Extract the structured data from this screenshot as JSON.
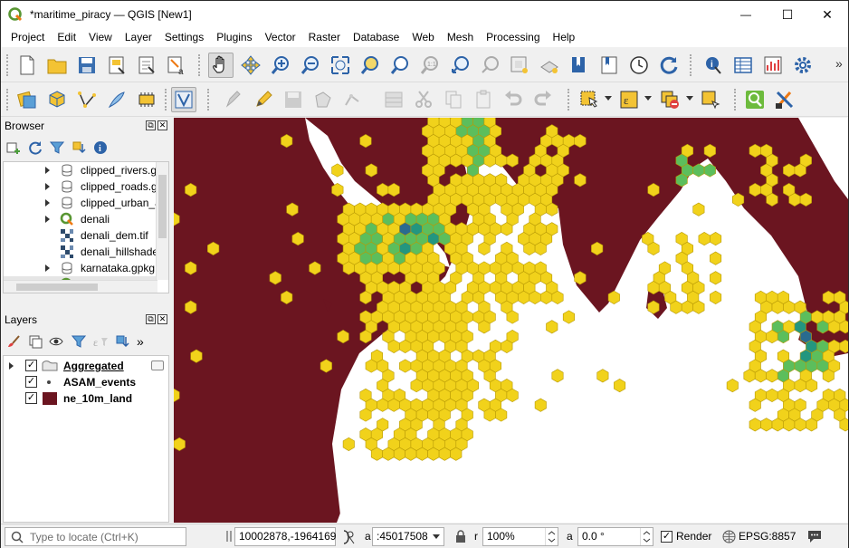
{
  "window": {
    "title": "*maritime_piracy — QGIS [New1]",
    "minimize_glyph": "—",
    "maximize_glyph": "☐",
    "close_glyph": "✕"
  },
  "menu": [
    "Project",
    "Edit",
    "View",
    "Layer",
    "Settings",
    "Plugins",
    "Vector",
    "Raster",
    "Database",
    "Web",
    "Mesh",
    "Processing",
    "Help"
  ],
  "toolbar_overflow": "»",
  "browser": {
    "title": "Browser",
    "items": [
      {
        "label": "clipped_rivers.g",
        "icon": "geopackage-icon",
        "expandable": true
      },
      {
        "label": "clipped_roads.g",
        "icon": "geopackage-icon",
        "expandable": true
      },
      {
        "label": "clipped_urban_a",
        "icon": "geopackage-icon",
        "expandable": true
      },
      {
        "label": "denali",
        "icon": "qgis-project-icon",
        "expandable": true
      },
      {
        "label": "denali_dem.tif",
        "icon": "raster-icon",
        "expandable": false
      },
      {
        "label": "denali_hillshade",
        "icon": "raster-icon",
        "expandable": false
      },
      {
        "label": "karnataka.gpkg",
        "icon": "geopackage-icon",
        "expandable": true
      },
      {
        "label": "maritime_piracy",
        "icon": "qgis-project-icon",
        "expandable": true,
        "selected": true
      }
    ]
  },
  "layers": {
    "title": "Layers",
    "items": [
      {
        "label": "Aggregated",
        "checked": true,
        "expandable": true,
        "icon": "polygon-layer-icon",
        "underline": true
      },
      {
        "label": "ASAM_events",
        "checked": true,
        "expandable": false,
        "icon": "point-symbol-icon"
      },
      {
        "label": "ne_10m_land",
        "checked": true,
        "expandable": false,
        "icon": "fill-symbol-icon"
      }
    ]
  },
  "status": {
    "locate_placeholder": "Type to locate (Ctrl+K)",
    "coordinate": "10002878,-1964169",
    "scale_label": "a",
    "scale_value": ":45017508",
    "magnifier_label": "r",
    "magnifier_value": "100%",
    "rotation_label": "a",
    "rotation_value": "0.0 °",
    "render_label": "Render",
    "render_checked": true,
    "crs": "EPSG:8857"
  },
  "colors": {
    "land": "#6b1520",
    "hex_yellow": "#f1d21b",
    "hex_stroke": "#b89a06",
    "hex_green": "#5cbe5c",
    "hex_teal": "#23967f",
    "hex_blue": "#2a6b8f"
  }
}
